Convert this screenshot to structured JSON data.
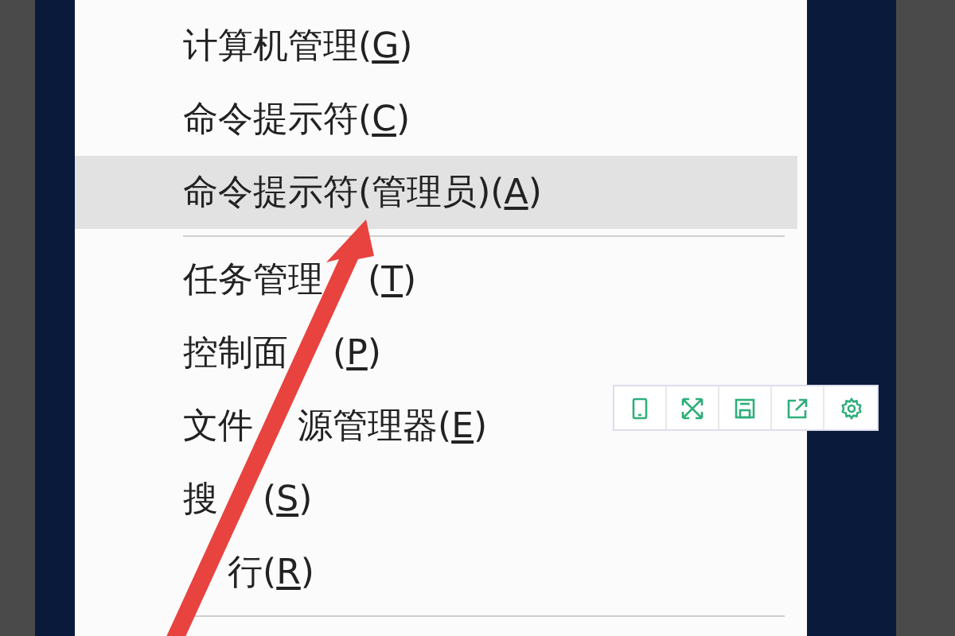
{
  "menu": {
    "items": [
      {
        "kind": "item",
        "parts": [
          "计算机管理("
        ],
        "key": "G",
        "suffix": ")",
        "selected": false
      },
      {
        "kind": "item",
        "parts": [
          "命令提示符("
        ],
        "key": "C",
        "suffix": ")",
        "selected": false
      },
      {
        "kind": "item",
        "parts": [
          "命令提示符(管理员)("
        ],
        "key": "A",
        "suffix": ")",
        "selected": true
      },
      {
        "kind": "separator"
      },
      {
        "kind": "item",
        "parts": [
          "任务管理",
          "("
        ],
        "key": "T",
        "suffix": ")",
        "selected": false
      },
      {
        "kind": "item",
        "parts": [
          "控制面",
          "("
        ],
        "key": "P",
        "suffix": ")",
        "selected": false
      },
      {
        "kind": "item",
        "parts": [
          "文件",
          "源管理器("
        ],
        "key": "E",
        "suffix": ")",
        "selected": false
      },
      {
        "kind": "item",
        "parts": [
          "搜",
          "("
        ],
        "key": "S",
        "suffix": ")",
        "selected": false
      },
      {
        "kind": "item",
        "covered_start": true,
        "parts": [
          "行("
        ],
        "key": "R",
        "suffix": ")",
        "selected": false
      },
      {
        "kind": "separator"
      }
    ]
  },
  "image_toolbar": {
    "buttons": [
      {
        "kind": "phone"
      },
      {
        "kind": "expand"
      },
      {
        "kind": "save"
      },
      {
        "kind": "share"
      },
      {
        "kind": "settings"
      }
    ]
  }
}
